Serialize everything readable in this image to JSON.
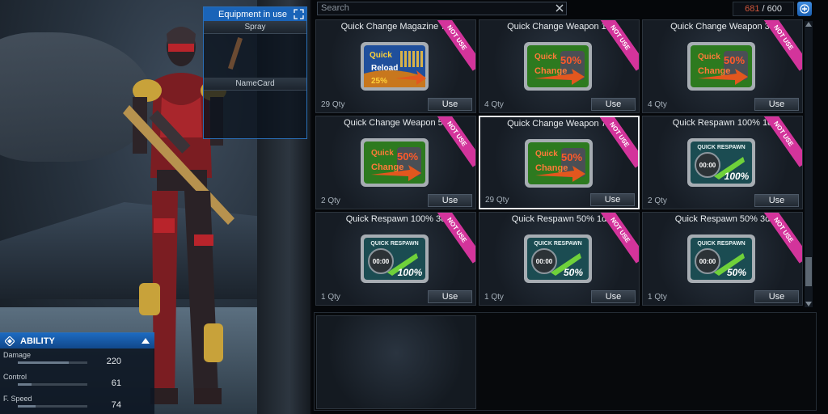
{
  "equipment": {
    "header": "Equipment in use",
    "slots": [
      {
        "label": "Spray"
      },
      {
        "label": "NameCard"
      }
    ]
  },
  "ability": {
    "title": "ABILITY",
    "stats": [
      {
        "name": "Damage",
        "value": "220",
        "fill": 0.73
      },
      {
        "name": "Control",
        "value": "61",
        "fill": 0.2
      },
      {
        "name": "F. Speed",
        "value": "74",
        "fill": 0.25
      }
    ]
  },
  "search": {
    "placeholder": "Search"
  },
  "capacity": {
    "used": "681",
    "max": "/ 600"
  },
  "items": [
    {
      "title": "Quick Change Magazine 7d",
      "qty": "29 Qty",
      "use": "Use",
      "badge": "NOT USE",
      "icon": "quick-reload-icon"
    },
    {
      "title": "Quick Change Weapon 1d",
      "qty": "4 Qty",
      "use": "Use",
      "badge": "NOT USE",
      "icon": "quick-change-icon"
    },
    {
      "title": "Quick Change Weapon 3d",
      "qty": "4 Qty",
      "use": "Use",
      "badge": "NOT USE",
      "icon": "quick-change-icon"
    },
    {
      "title": "Quick Change Weapon 5d",
      "qty": "2 Qty",
      "use": "Use",
      "badge": "NOT USE",
      "icon": "quick-change-icon"
    },
    {
      "title": "Quick Change Weapon 7d",
      "qty": "29 Qty",
      "use": "Use",
      "badge": "NOT USE",
      "icon": "quick-change-icon",
      "selected": true
    },
    {
      "title": "Quick Respawn 100% 1d",
      "qty": "2 Qty",
      "use": "Use",
      "badge": "NOT USE",
      "icon": "quick-respawn-icon"
    },
    {
      "title": "Quick Respawn 100% 3d",
      "qty": "1 Qty",
      "use": "Use",
      "badge": "NOT USE",
      "icon": "quick-respawn-icon"
    },
    {
      "title": "Quick Respawn 50% 1d",
      "qty": "1 Qty",
      "use": "Use",
      "badge": "NOT USE",
      "icon": "quick-respawn-icon"
    },
    {
      "title": "Quick Respawn 50% 3d",
      "qty": "1 Qty",
      "use": "Use",
      "badge": "NOT USE",
      "icon": "quick-respawn-icon"
    }
  ],
  "icon_text": {
    "reload_quick": "Quick",
    "reload_word": "Reload",
    "reload_pct": "25%",
    "change_quick": "Quick",
    "change_word": "Change",
    "change_pct": "50%",
    "respawn_title": "QUICK RESPAWN",
    "respawn_time": "00:00",
    "respawn_100": "100%",
    "respawn_50": "50%"
  },
  "colors": {
    "accent": "#1a64b8",
    "badge": "#d3349b",
    "count_used": "#d0563b"
  }
}
